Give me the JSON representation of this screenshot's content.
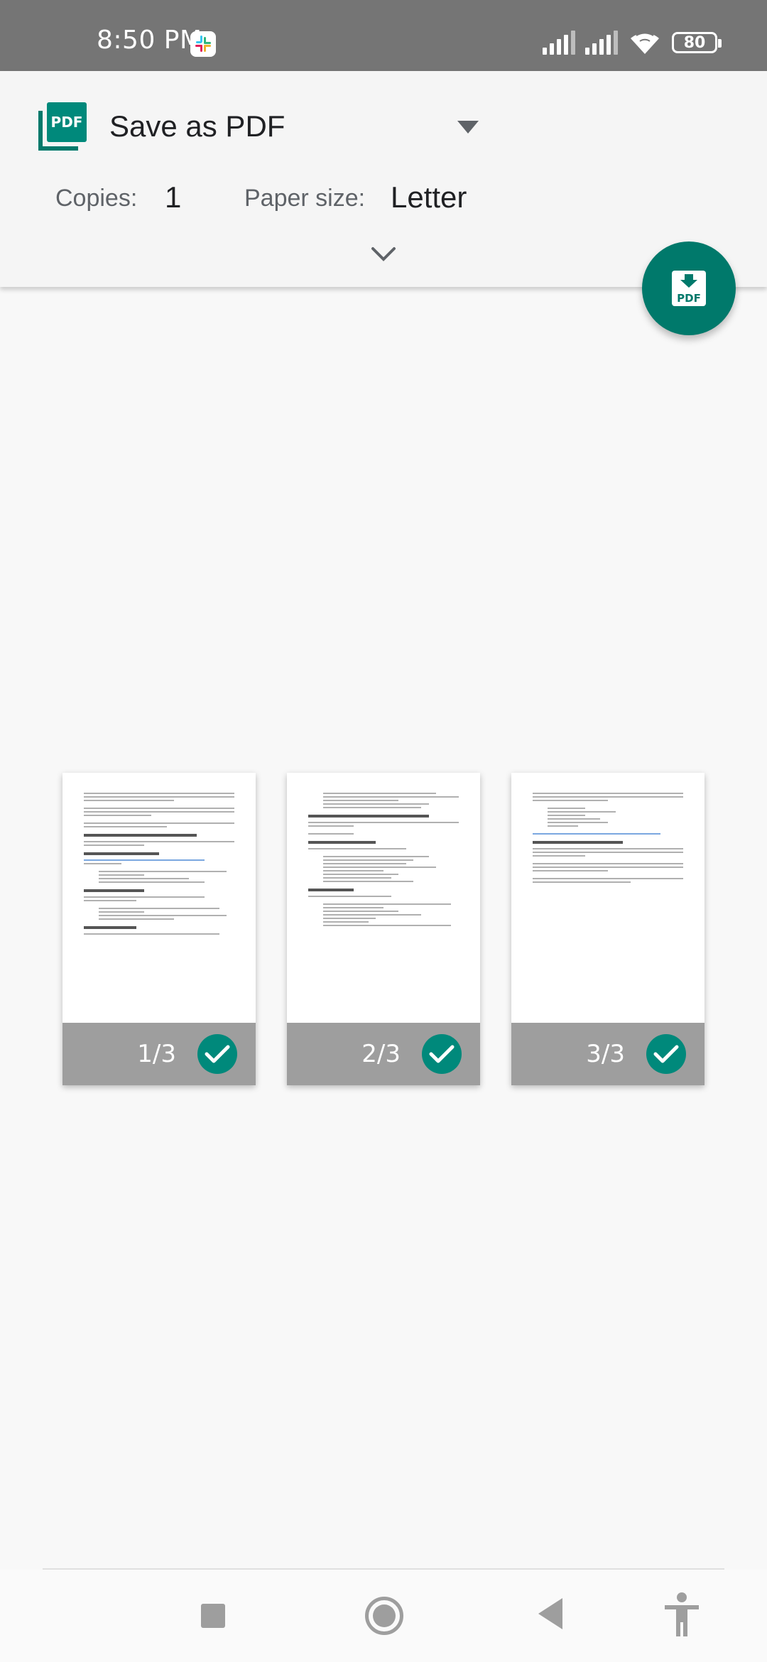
{
  "status_bar": {
    "time": "8:50 PM",
    "battery": "80",
    "icons": [
      "slack-icon",
      "signal-icon",
      "signal-icon",
      "wifi-icon",
      "battery-icon"
    ]
  },
  "print": {
    "destination": "Save as PDF",
    "copies_label": "Copies:",
    "copies_value": "1",
    "paper_label": "Paper size:",
    "paper_value": "Letter"
  },
  "pages": [
    {
      "label": "1/3",
      "selected": true
    },
    {
      "label": "2/3",
      "selected": true
    },
    {
      "label": "3/3",
      "selected": true
    }
  ],
  "nav": {
    "icons": [
      "recent-apps-icon",
      "home-icon",
      "back-icon",
      "accessibility-icon"
    ]
  },
  "colors": {
    "accent": "#00796b",
    "check": "#00897b",
    "status_bar": "#757575",
    "page_footer": "#9e9e9e"
  }
}
